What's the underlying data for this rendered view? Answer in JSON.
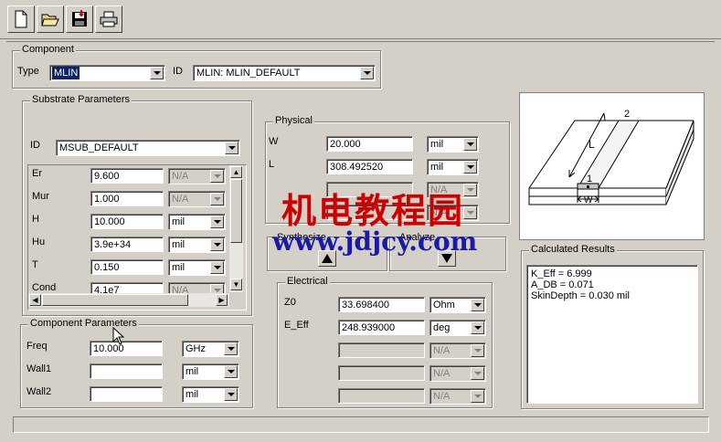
{
  "toolbar": {
    "buttons": [
      "new-icon",
      "open-icon",
      "save-icon",
      "print-icon"
    ]
  },
  "component": {
    "group_title": "Component",
    "type_label": "Type",
    "type_value": "MLIN",
    "id_label": "ID",
    "id_value": "MLIN: MLIN_DEFAULT"
  },
  "substrate": {
    "group_title": "Substrate Parameters",
    "id_label": "ID",
    "id_value": "MSUB_DEFAULT",
    "rows": [
      {
        "label": "Er",
        "value": "9.600",
        "unit": "N/A",
        "unit_disabled": true
      },
      {
        "label": "Mur",
        "value": "1.000",
        "unit": "N/A",
        "unit_disabled": true
      },
      {
        "label": "H",
        "value": "10.000",
        "unit": "mil",
        "unit_disabled": false
      },
      {
        "label": "Hu",
        "value": "3.9e+34",
        "unit": "mil",
        "unit_disabled": false
      },
      {
        "label": "T",
        "value": "0.150",
        "unit": "mil",
        "unit_disabled": false
      },
      {
        "label": "Cond",
        "value": "4.1e7",
        "unit": "N/A",
        "unit_disabled": true
      }
    ]
  },
  "component_params": {
    "group_title": "Component Parameters",
    "rows": [
      {
        "label": "Freq",
        "value": "10.000",
        "unit": "GHz"
      },
      {
        "label": "Wall1",
        "value": "",
        "unit": "mil"
      },
      {
        "label": "Wall2",
        "value": "",
        "unit": "mil"
      }
    ]
  },
  "physical": {
    "group_title": "Physical",
    "rows": [
      {
        "label": "W",
        "value": "20.000",
        "unit": "mil",
        "disabled": false
      },
      {
        "label": "L",
        "value": "308.492520",
        "unit": "mil",
        "disabled": false
      },
      {
        "label": "",
        "value": "",
        "unit": "N/A",
        "disabled": true
      },
      {
        "label": "",
        "value": "",
        "unit": "N/A",
        "disabled": true
      }
    ]
  },
  "synthesize": {
    "label": "Synthesize"
  },
  "analyze": {
    "label": "Analyze"
  },
  "electrical": {
    "group_title": "Electrical",
    "rows": [
      {
        "label": "Z0",
        "value": "33.698400",
        "unit": "Ohm",
        "disabled": false
      },
      {
        "label": "E_Eff",
        "value": "248.939000",
        "unit": "deg",
        "disabled": false
      },
      {
        "label": "",
        "value": "",
        "unit": "N/A",
        "disabled": true
      },
      {
        "label": "",
        "value": "",
        "unit": "N/A",
        "disabled": true
      },
      {
        "label": "",
        "value": "",
        "unit": "N/A",
        "disabled": true
      }
    ]
  },
  "diagram": {
    "label_L": "L",
    "label_W": "W",
    "port1": "1",
    "port2": "2"
  },
  "results": {
    "group_title": "Calculated Results",
    "lines": [
      "K_Eff = 6.999",
      "A_DB = 0.071",
      "SkinDepth = 0.030 mil"
    ]
  },
  "watermark": {
    "line1": "机电教程园",
    "line2": "www.jdjcy.com"
  }
}
